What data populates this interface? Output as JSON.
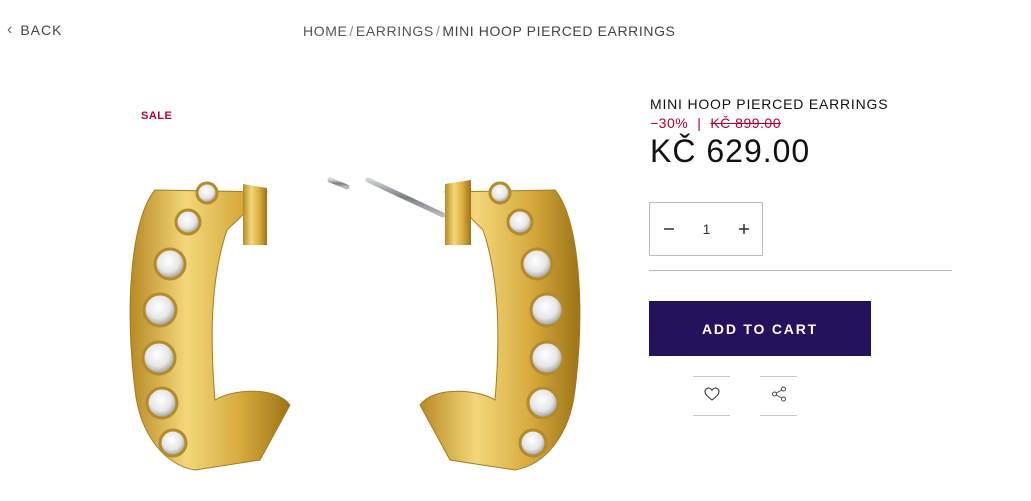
{
  "nav": {
    "back_label": "BACK",
    "breadcrumb": {
      "home": "HOME",
      "sep1": "/",
      "category": "EARRINGS",
      "sep2": "/",
      "current": "MINI HOOP PIERCED EARRINGS"
    }
  },
  "product": {
    "badge": "SALE",
    "name": "MINI HOOP PIERCED EARRINGS",
    "discount": "−30%",
    "price_separator": "|",
    "old_price": "KČ 899.00",
    "price": "KČ 629.00",
    "quantity": "1",
    "add_to_cart_label": "ADD TO CART",
    "image_icon": "gold-crystal-hoop-earrings"
  },
  "icons": {
    "back": "chevron-left-icon",
    "decrease": "minus-icon",
    "increase": "plus-icon",
    "wishlist": "heart-icon",
    "share": "share-icon"
  },
  "colors": {
    "sale_red": "#b3002d",
    "cart_button": "#24125e",
    "gold": "#d9b24a"
  }
}
